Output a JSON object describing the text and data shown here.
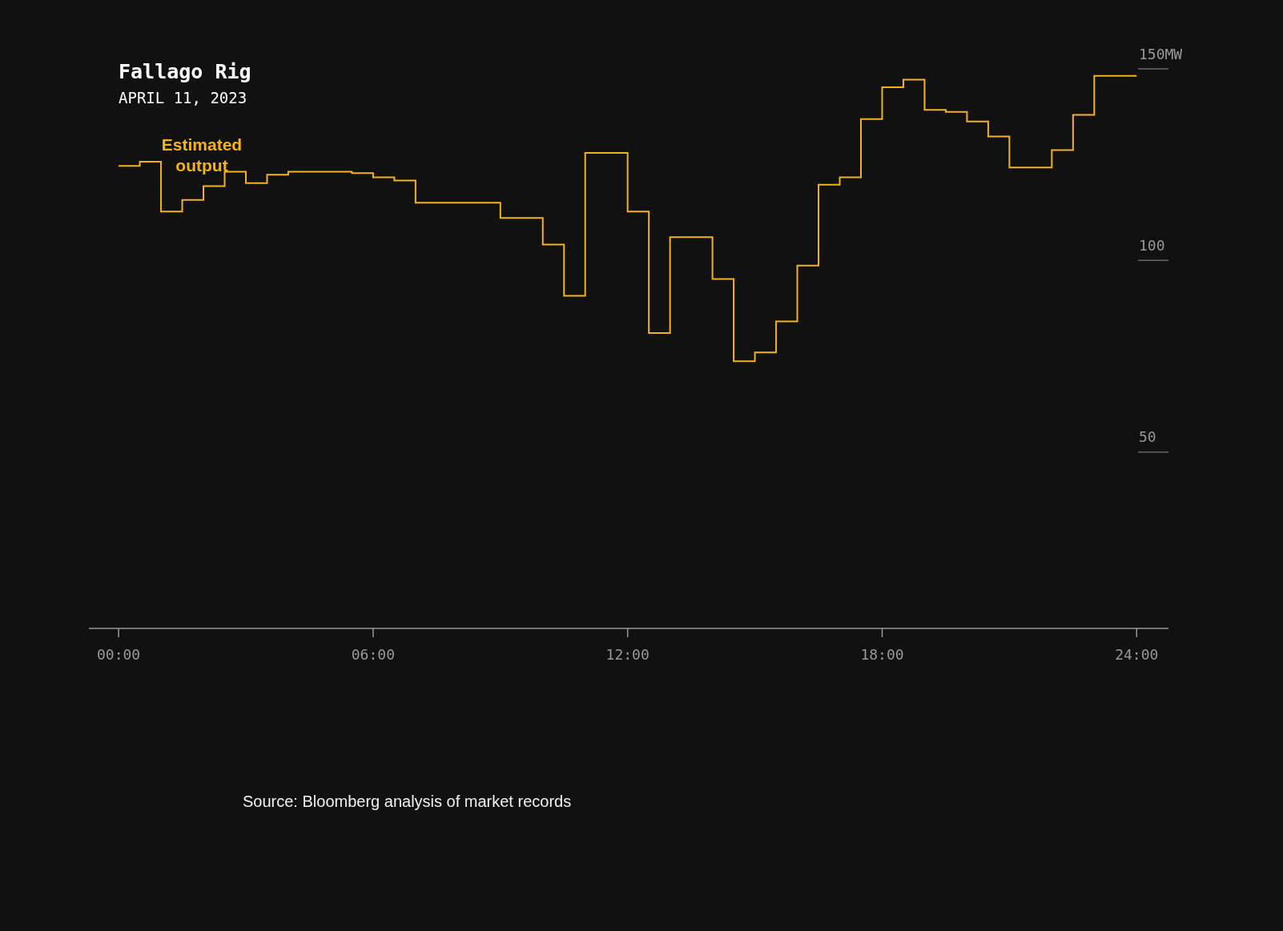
{
  "chart": {
    "chart_data": {
      "type": "line",
      "title": "Fallago Rig",
      "subtitle": "APRIL 11, 2023",
      "x": [
        0,
        0.5,
        0.5,
        1,
        1,
        1.5,
        1.5,
        2,
        2,
        2.5,
        2.5,
        3,
        3,
        3.5,
        3.5,
        4,
        4,
        5.5,
        5.5,
        6,
        6,
        6.5,
        6.5,
        7,
        7,
        9,
        9,
        10,
        10,
        10.5,
        10.5,
        11,
        11,
        12,
        12,
        12.5,
        12.5,
        13,
        13,
        14,
        14,
        14.5,
        14.5,
        15,
        15,
        15.5,
        15.5,
        16,
        16,
        16.5,
        16.5,
        17,
        17,
        17.5,
        17.5,
        18,
        18,
        18.5,
        18.5,
        19,
        19,
        19.5,
        19.5,
        20,
        20,
        20.5,
        20.5,
        21,
        21,
        22,
        22,
        22.5,
        22.5,
        23,
        23,
        24
      ],
      "series": [
        {
          "name": "Estimated output",
          "color": "#f5b31b",
          "values": [
            120.7,
            120.7,
            121.8,
            121.8,
            108.8,
            108.8,
            111.8,
            111.8,
            115.4,
            115.4,
            119.2,
            119.2,
            116.2,
            116.2,
            118.4,
            118.4,
            119.2,
            119.2,
            118.8,
            118.8,
            117.7,
            117.7,
            116.9,
            116.9,
            111.1,
            111.1,
            107.1,
            107.1,
            100.2,
            100.2,
            86.8,
            86.8,
            124.1,
            124.1,
            108.8,
            108.8,
            77.1,
            77.1,
            102.1,
            102.1,
            91.2,
            91.2,
            69.7,
            69.7,
            72.0,
            72.0,
            80.1,
            80.1,
            94.7,
            94.7,
            115.8,
            115.8,
            117.7,
            117.7,
            132.9,
            132.9,
            141.2,
            141.2,
            143.2,
            143.2,
            135.3,
            135.3,
            134.8,
            134.8,
            132.3,
            132.3,
            128.4,
            128.4,
            120.3,
            120.3,
            124.8,
            124.8,
            134.0,
            134.0,
            144.2,
            144.2
          ]
        }
      ],
      "xlim": [
        -0.7,
        24.75
      ],
      "ylim": [
        0,
        150
      ],
      "xticks": [
        {
          "value": 0,
          "label": "00:00"
        },
        {
          "value": 6,
          "label": "06:00"
        },
        {
          "value": 12,
          "label": "12:00"
        },
        {
          "value": 18,
          "label": "18:00"
        },
        {
          "value": 24,
          "label": "24:00"
        }
      ],
      "yticks": [
        {
          "value": 50,
          "label": "50"
        },
        {
          "value": 100,
          "label": "100"
        },
        {
          "value": 150,
          "label": "150MW"
        }
      ]
    }
  },
  "source": "Source: Bloomberg analysis of market records"
}
